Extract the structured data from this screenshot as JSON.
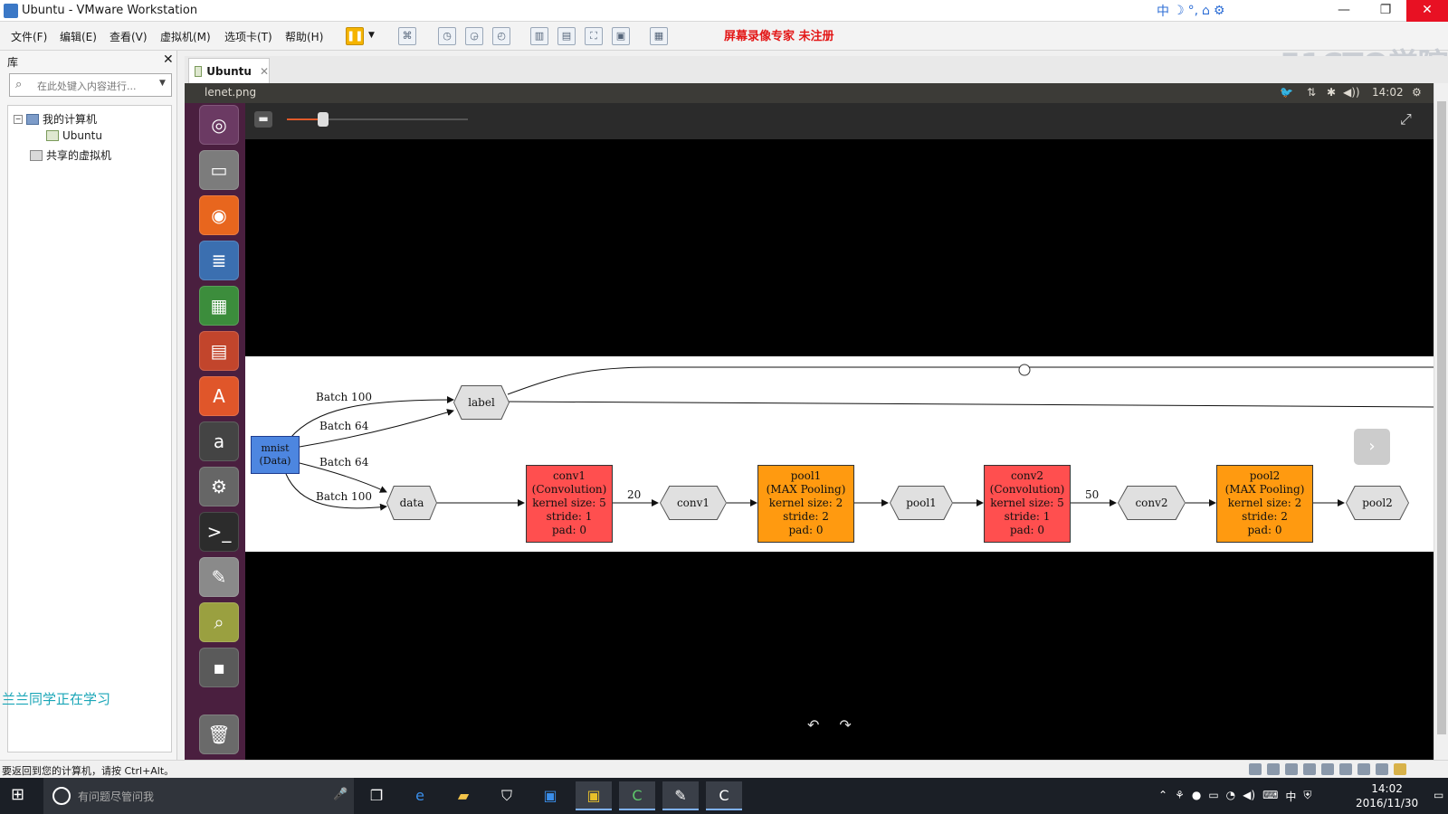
{
  "window": {
    "title": "Ubuntu - VMware Workstation",
    "minimize": "—",
    "restore": "❐",
    "close": "✕",
    "ime_icons": [
      "中",
      "☽",
      "°,",
      "⌂",
      "⚙"
    ]
  },
  "menu": {
    "items": [
      "文件(F)",
      "编辑(E)",
      "查看(V)",
      "虚拟机(M)",
      "选项卡(T)",
      "帮助(H)"
    ],
    "banner": "屏幕录像专家  未注册",
    "watermark": "51CTO学院"
  },
  "library": {
    "header": "库",
    "close": "✕",
    "search_placeholder": "在此处键入内容进行...",
    "tree": {
      "my_computer": "我的计算机",
      "ubuntu": "Ubuntu",
      "shared": "共享的虚拟机"
    },
    "overlay_text": "兰兰同学正在学习"
  },
  "tab": {
    "label": "Ubuntu",
    "close": "✕"
  },
  "vm": {
    "filename": "lenet.png",
    "clock": "14:02",
    "tray_icons": [
      "⇅",
      "✱",
      "◀))",
      "⚙"
    ],
    "fit_btn": "▬",
    "fullscreen": "⤢",
    "rotate_left": "↶",
    "rotate_right": "↷",
    "next": "›"
  },
  "diagram": {
    "mnist": [
      "mnist",
      "(Data)"
    ],
    "label_node": "label",
    "data_node": "data",
    "edge_labels": [
      "Batch 100",
      "Batch 64",
      "Batch 64",
      "Batch 100",
      "20",
      "50"
    ],
    "conv1_box": [
      "conv1",
      "(Convolution)",
      "kernel size: 5",
      "stride: 1",
      "pad: 0"
    ],
    "conv1_node": "conv1",
    "pool1_box": [
      "pool1",
      "(MAX Pooling)",
      "kernel size: 2",
      "stride: 2",
      "pad: 0"
    ],
    "pool1_node": "pool1",
    "conv2_box": [
      "conv2",
      "(Convolution)",
      "kernel size: 5",
      "stride: 1",
      "pad: 0"
    ],
    "conv2_node": "conv2",
    "pool2_box": [
      "pool2",
      "(MAX Pooling)",
      "kernel size: 2",
      "stride: 2",
      "pad: 0"
    ],
    "pool2_node": "pool2"
  },
  "statusbar": {
    "message": "要返回到您的计算机，请按 Ctrl+Alt。"
  },
  "taskbar": {
    "search_placeholder": "有问题尽管问我",
    "lang": "中",
    "time": "14:02",
    "date": "2016/11/30"
  },
  "colors": {
    "conv": "#ff4f4f",
    "pool": "#ff9a10",
    "data": "#4d86e0",
    "launcher": "#4a1f3f"
  }
}
